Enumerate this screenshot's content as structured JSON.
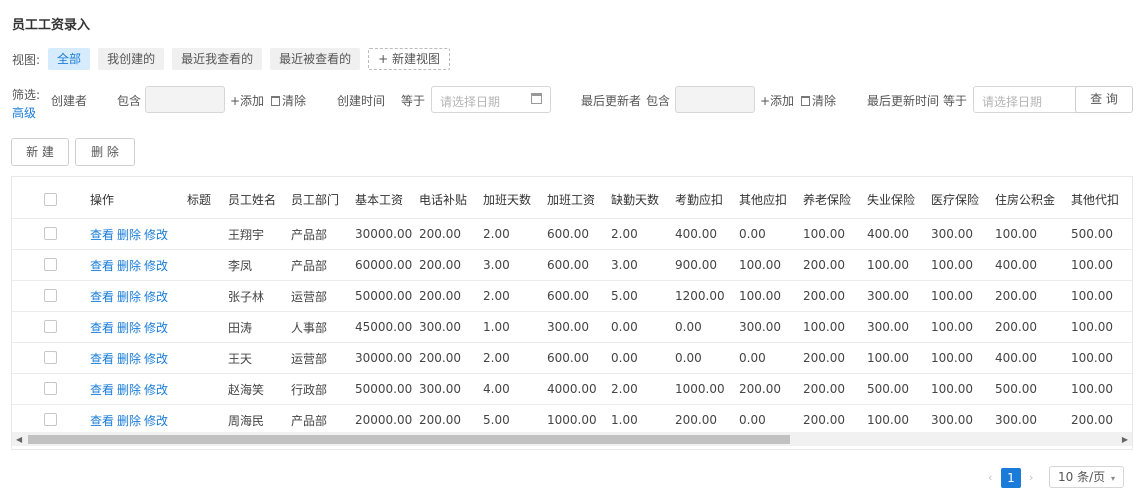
{
  "page": {
    "title": "员工工资录入"
  },
  "views": {
    "label": "视图:",
    "items": [
      "全部",
      "我创建的",
      "最近我查看的",
      "最近被查看的"
    ],
    "new_view": "+ 新建视图"
  },
  "filter": {
    "label": "筛选:",
    "advanced": "高级",
    "creator": {
      "field": "创建者",
      "op": "包含",
      "add": "+添加",
      "clear": "清除"
    },
    "created_time": {
      "field": "创建时间",
      "op": "等于",
      "placeholder": "请选择日期"
    },
    "updater": {
      "field": "最后更新者",
      "op": "包含",
      "add": "+添加",
      "clear": "清除"
    },
    "updated_time": {
      "field": "最后更新时间",
      "op": "等于",
      "placeholder": "请选择日期"
    },
    "query": "查 询"
  },
  "actions": {
    "new": "新 建",
    "delete": "删 除"
  },
  "table": {
    "headers": [
      "操作",
      "标题",
      "员工姓名",
      "员工部门",
      "基本工资",
      "电话补贴",
      "加班天数",
      "加班工资",
      "缺勤天数",
      "考勤应扣",
      "其他应扣",
      "养老保险",
      "失业保险",
      "医疗保险",
      "住房公积金",
      "其他代扣"
    ],
    "row_actions": [
      "查看",
      "删除",
      "修改"
    ],
    "rows": [
      [
        "",
        "王翔宇",
        "产品部",
        "30000.00",
        "200.00",
        "2.00",
        "600.00",
        "2.00",
        "400.00",
        "0.00",
        "100.00",
        "400.00",
        "300.00",
        "100.00",
        "500.00"
      ],
      [
        "",
        "李凤",
        "产品部",
        "60000.00",
        "200.00",
        "3.00",
        "600.00",
        "3.00",
        "900.00",
        "100.00",
        "200.00",
        "100.00",
        "100.00",
        "400.00",
        "100.00"
      ],
      [
        "",
        "张子林",
        "运营部",
        "50000.00",
        "200.00",
        "2.00",
        "600.00",
        "5.00",
        "1200.00",
        "100.00",
        "200.00",
        "300.00",
        "100.00",
        "200.00",
        "100.00"
      ],
      [
        "",
        "田涛",
        "人事部",
        "45000.00",
        "300.00",
        "1.00",
        "300.00",
        "0.00",
        "0.00",
        "300.00",
        "100.00",
        "300.00",
        "100.00",
        "200.00",
        "100.00"
      ],
      [
        "",
        "王天",
        "运营部",
        "30000.00",
        "200.00",
        "2.00",
        "600.00",
        "0.00",
        "0.00",
        "0.00",
        "200.00",
        "100.00",
        "100.00",
        "400.00",
        "100.00"
      ],
      [
        "",
        "赵海笑",
        "行政部",
        "50000.00",
        "300.00",
        "4.00",
        "4000.00",
        "2.00",
        "1000.00",
        "200.00",
        "200.00",
        "500.00",
        "100.00",
        "500.00",
        "100.00"
      ],
      [
        "",
        "周海民",
        "产品部",
        "20000.00",
        "200.00",
        "5.00",
        "1000.00",
        "1.00",
        "200.00",
        "0.00",
        "200.00",
        "100.00",
        "300.00",
        "300.00",
        "200.00"
      ]
    ]
  },
  "pagination": {
    "current": "1",
    "page_size": "10 条/页"
  },
  "icons": {
    "calendar": "calendar-icon",
    "trash": "trash-icon",
    "prev": "chevron-left-icon",
    "next": "chevron-right-icon",
    "dropdown": "chevron-down-icon"
  },
  "colors": {
    "accent": "#1a7cd8",
    "active_view_bg": "#d6ebfb"
  }
}
